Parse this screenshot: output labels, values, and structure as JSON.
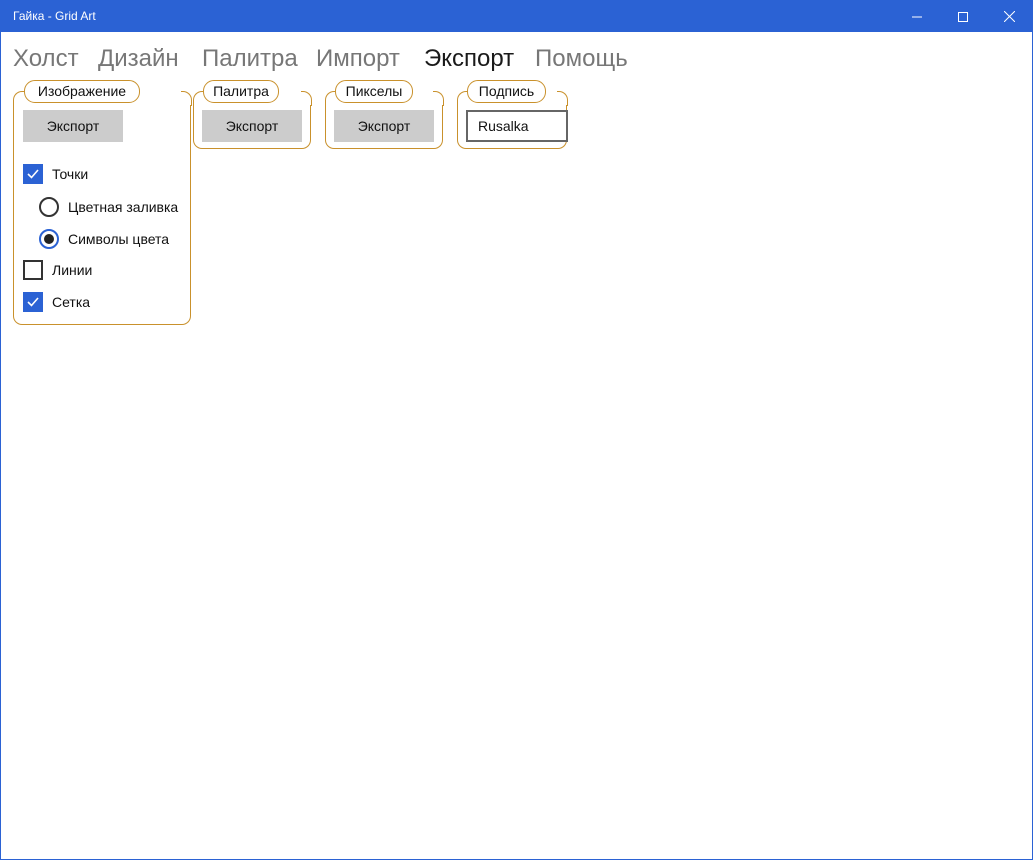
{
  "window": {
    "title": "Гайка - Grid Art",
    "accent_color": "#2b62d4",
    "controls": [
      "minimize-icon",
      "maximize-icon",
      "close-icon"
    ]
  },
  "nav": {
    "items": [
      "Холст",
      "Дизайн",
      "Палитра",
      "Импорт",
      "Экспорт",
      "Помощь"
    ],
    "active": "Экспорт"
  },
  "groups": {
    "image": {
      "legend": "Изображение",
      "export_label": "Экспорт",
      "dots": {
        "label": "Точки",
        "checked": true
      },
      "fill": {
        "label": "Цветная заливка",
        "selected": false
      },
      "symbols": {
        "label": "Символы цвета",
        "selected": true
      },
      "lines": {
        "label": "Линии",
        "checked": false
      },
      "grid": {
        "label": "Сетка",
        "checked": true
      }
    },
    "palette": {
      "legend": "Палитра",
      "export_label": "Экспорт"
    },
    "pixels": {
      "legend": "Пикселы",
      "export_label": "Экспорт"
    },
    "caption": {
      "legend": "Подпись",
      "value": "Rusalka"
    }
  },
  "group_border_color": "#c9912c"
}
